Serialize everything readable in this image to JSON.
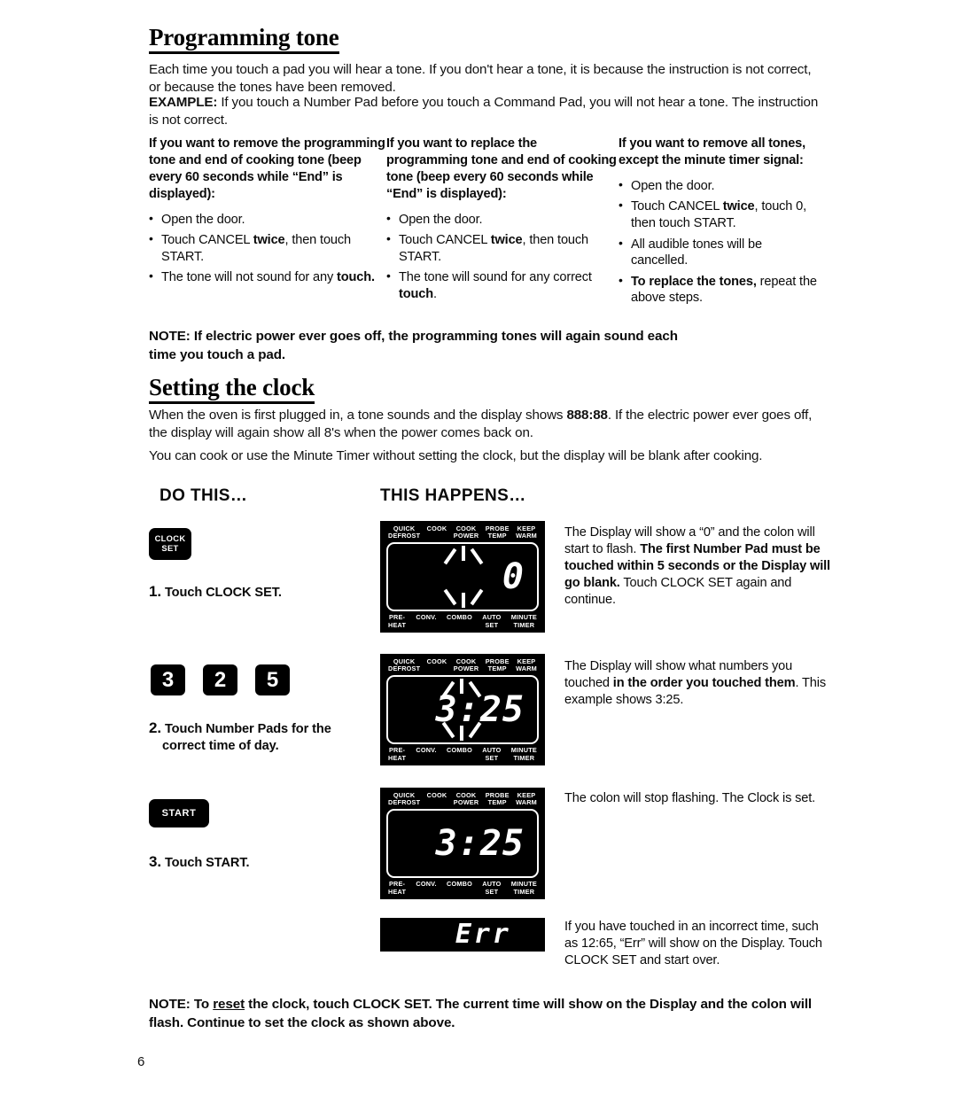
{
  "page": {
    "number": "6"
  },
  "section1": {
    "heading": "Programming tone",
    "para1": "Each time you touch a pad you will hear a tone. If you don't hear a tone, it is because the instruction is not correct, or because the tones have been removed.",
    "example_label": "EXAMPLE:",
    "example_text": " If you touch a Number Pad before you touch a Command Pad, you will not hear a tone. The instruction is not correct.",
    "columns": [
      {
        "title": "If you want to remove the programming tone and end of cooking tone (beep every 60 seconds while “End” is displayed):",
        "bullets": [
          {
            "html": "Open the door."
          },
          {
            "html": "Touch CANCEL <b>twice</b>, then touch START."
          },
          {
            "html": "The tone will not sound for any <b>touch.</b>"
          }
        ]
      },
      {
        "title": "If you want to replace the programming tone and end of cooking tone (beep every 60 seconds while “End” is displayed):",
        "bullets": [
          {
            "html": "Open the door."
          },
          {
            "html": "Touch CANCEL <b>twice</b>, then touch START."
          },
          {
            "html": "The tone will sound for any correct <b>touch</b>."
          }
        ]
      },
      {
        "title": "If you want to remove all tones, except the minute timer signal:",
        "bullets": [
          {
            "html": "Open the door."
          },
          {
            "html": "Touch CANCEL <b>twice</b>, touch 0, then touch START."
          },
          {
            "html": "All audible tones will be cancelled."
          },
          {
            "html": "<b>To replace the tones,</b> repeat the above steps."
          }
        ]
      }
    ],
    "note": "NOTE: If electric power ever goes off, the programming tones will again sound each time you touch a pad."
  },
  "section2": {
    "heading": "Setting the clock",
    "para1_a": "When the oven is first plugged in, a tone sounds and the display shows ",
    "para1_bold": "888:88",
    "para1_b": ". If the electric power ever goes off, the display will again show all 8's when the power comes back on.",
    "para2": "You can cook or use the Minute Timer without setting the clock, but the display will be blank after cooking.",
    "col_head_left": "DO THIS…",
    "col_head_right": "THIS HAPPENS…",
    "pads": {
      "clock_set": "CLOCK\nSET",
      "clock_set_line1": "CLOCK",
      "clock_set_line2": "SET",
      "num1": "3",
      "num2": "2",
      "num3": "5",
      "start": "START"
    },
    "steps": [
      {
        "num": "1.",
        "text": "Touch CLOCK SET."
      },
      {
        "num": "2.",
        "text_line1": "Touch Number Pads for the",
        "text_line2": "correct time of day."
      },
      {
        "num": "3.",
        "text": "Touch START."
      }
    ],
    "display_labels": {
      "top": [
        {
          "line1": "QUICK",
          "line2": "DEFROST"
        },
        {
          "line1": "COOK",
          "line2": ""
        },
        {
          "line1": "COOK",
          "line2": "POWER"
        },
        {
          "line1": "PROBE",
          "line2": "TEMP"
        },
        {
          "line1": "KEEP",
          "line2": "WARM"
        }
      ],
      "bottom": [
        {
          "line1": "PRE-",
          "line2": "HEAT"
        },
        {
          "line1": "CONV.",
          "line2": ""
        },
        {
          "line1": "COMBO",
          "line2": ""
        },
        {
          "line1": "AUTO",
          "line2": "SET"
        },
        {
          "line1": "MINUTE",
          "line2": "TIMER"
        }
      ]
    },
    "displays": [
      {
        "value": "0",
        "flashing": true
      },
      {
        "value": "3:25",
        "flashing": true
      },
      {
        "value": "3:25",
        "flashing": false
      },
      {
        "value": "Err",
        "flashing": false
      }
    ],
    "explanations": [
      "The Display will show a “0” and the colon will start to flash. <b>The first Number Pad must be touched within 5 seconds or the Display will go blank.</b> Touch CLOCK SET again and continue.",
      "The Display will show what numbers you touched <b>in the order you touched them</b>. This example shows 3:25.",
      "The colon will stop flashing. The Clock is set.",
      "If you have touched in an incorrect time, such as 12:65, “Err” will show on the Display. Touch CLOCK SET and start over."
    ],
    "note": "NOTE: To <span class=\"u\">reset</span> the clock, touch CLOCK SET. The current time will show on the Display and the colon will flash. Continue to set the clock as shown above."
  }
}
